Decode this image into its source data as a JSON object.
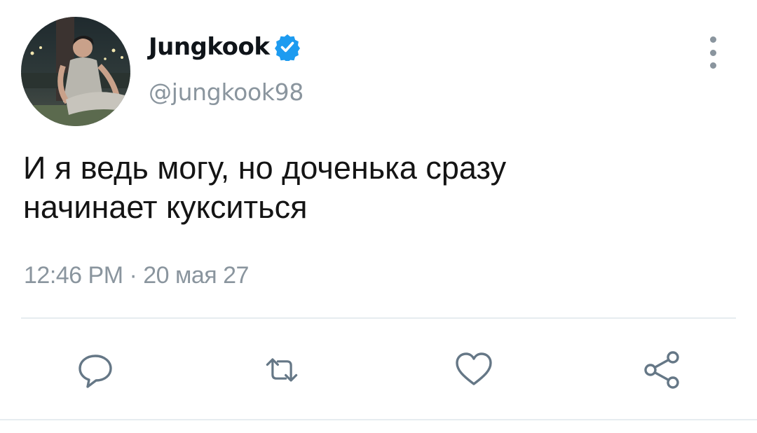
{
  "tweet": {
    "author": {
      "display_name": "Jungkook",
      "handle": "@jungkook98",
      "verified": true,
      "avatar_icon": "profile-photo"
    },
    "text_lines": [
      "И я ведь могу, но доченька сразу",
      "начинает кукситься"
    ],
    "timestamp": "12:46 PM · 20 мая 27"
  },
  "actions": {
    "reply_icon": "reply-icon",
    "retweet_icon": "retweet-icon",
    "like_icon": "heart-icon",
    "share_icon": "share-icon",
    "more_icon": "more-vertical-icon"
  },
  "colors": {
    "verified_blue": "#1d9bf0",
    "secondary_text": "#8a959e",
    "divider": "#e6ecf0",
    "icon_stroke": "#657786"
  }
}
